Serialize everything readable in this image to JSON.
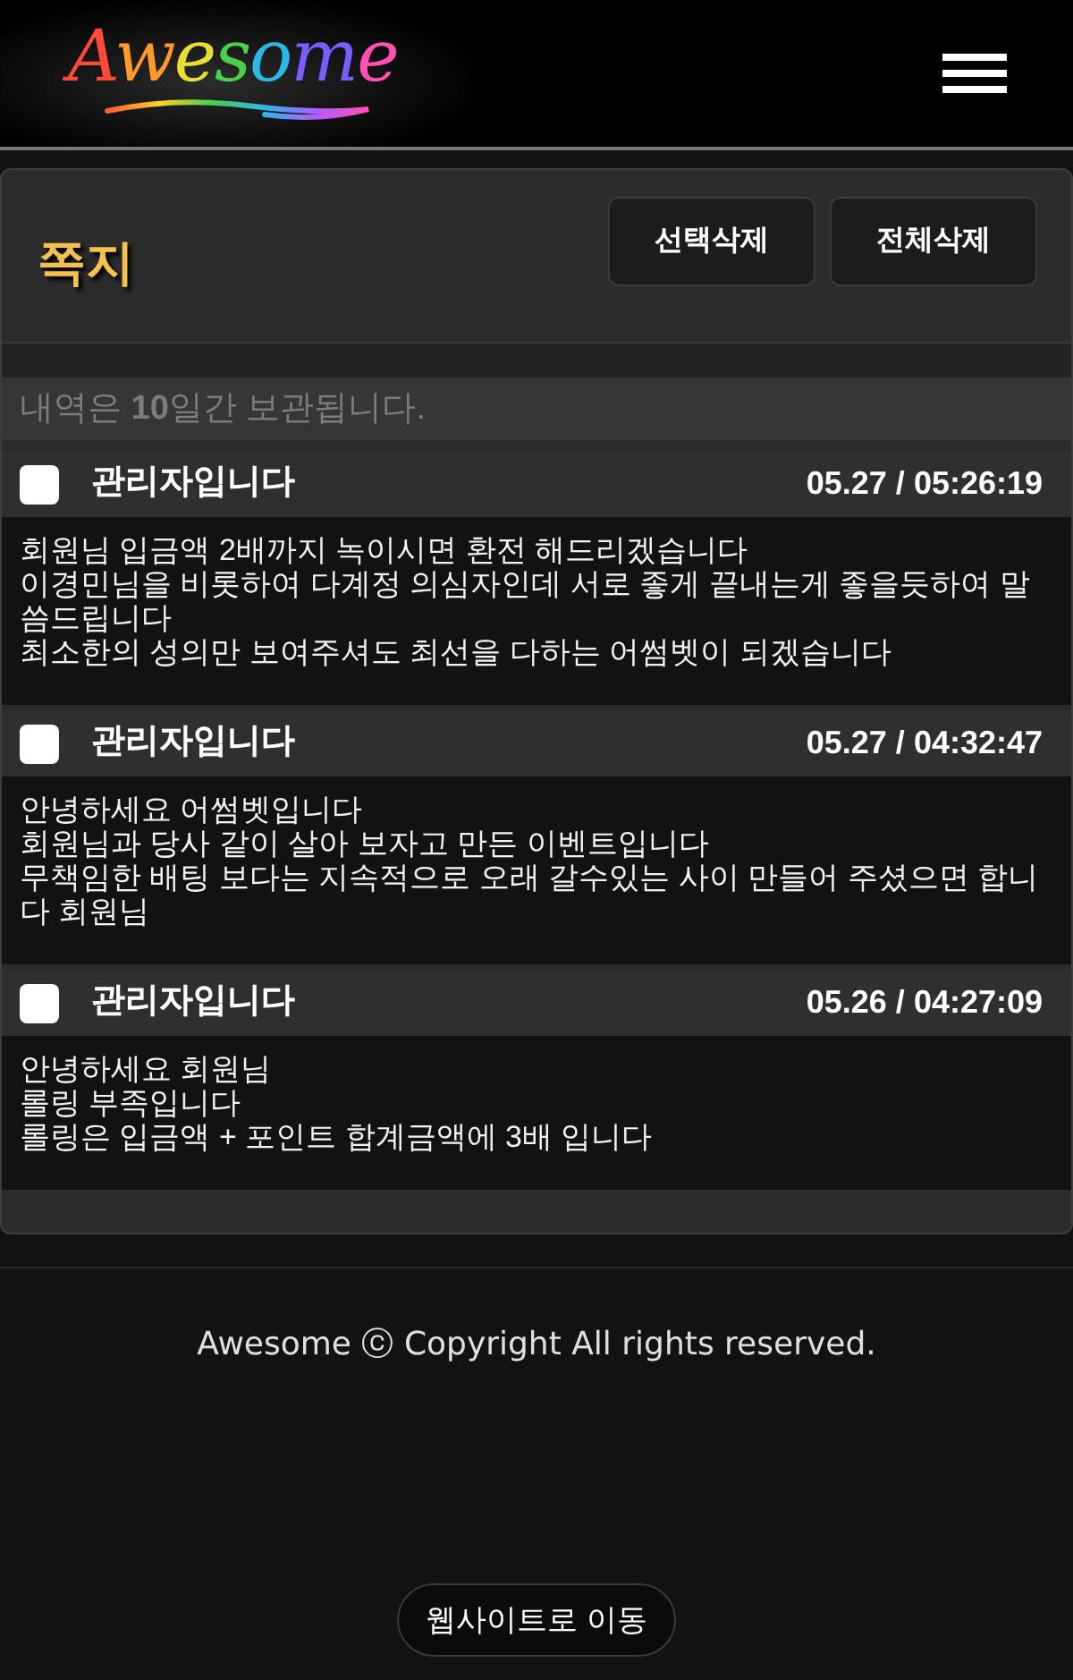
{
  "header": {
    "logo": "Awesome"
  },
  "panel": {
    "title": "쪽지",
    "buttons": [
      "선택삭제",
      "전체삭제"
    ],
    "notice": "내역은 **10**일간 보관됩니다."
  },
  "messages": [
    {
      "checked": false,
      "sender": "관리자입니다",
      "time": "05.27 / 05:26:19",
      "body": "회원님 입금액 2배까지 녹이시면 환전 해드리겠습니다\n이경민님을 비롯하여 다계정 의심자인데 서로 좋게 끝내는게 좋을듯하여 말씀드립니다\n최소한의 성의만 보여주셔도 최선을 다하는 어썸벳이 되겠습니다"
    },
    {
      "checked": false,
      "sender": "관리자입니다",
      "time": "05.27 / 04:32:47",
      "body": "안녕하세요 어썸벳입니다\n회원님과 당사 같이 살아 보자고 만든 이벤트입니다\n무책임한 배팅 보다는 지속적으로 오래 갈수있는 사이 만들어 주셨으면 합니다 회원님"
    },
    {
      "checked": false,
      "sender": "관리자입니다",
      "time": "05.26 / 04:27:09",
      "body": "안녕하세요 회원님\n롤링 부족입니다\n롤링은 입금액 + 포인트 합계금액에 3배 입니다"
    }
  ],
  "footer": {
    "copyright": "Awesome ⓒ Copyright All rights reserved.",
    "website_button": "웹사이트로 이동"
  }
}
